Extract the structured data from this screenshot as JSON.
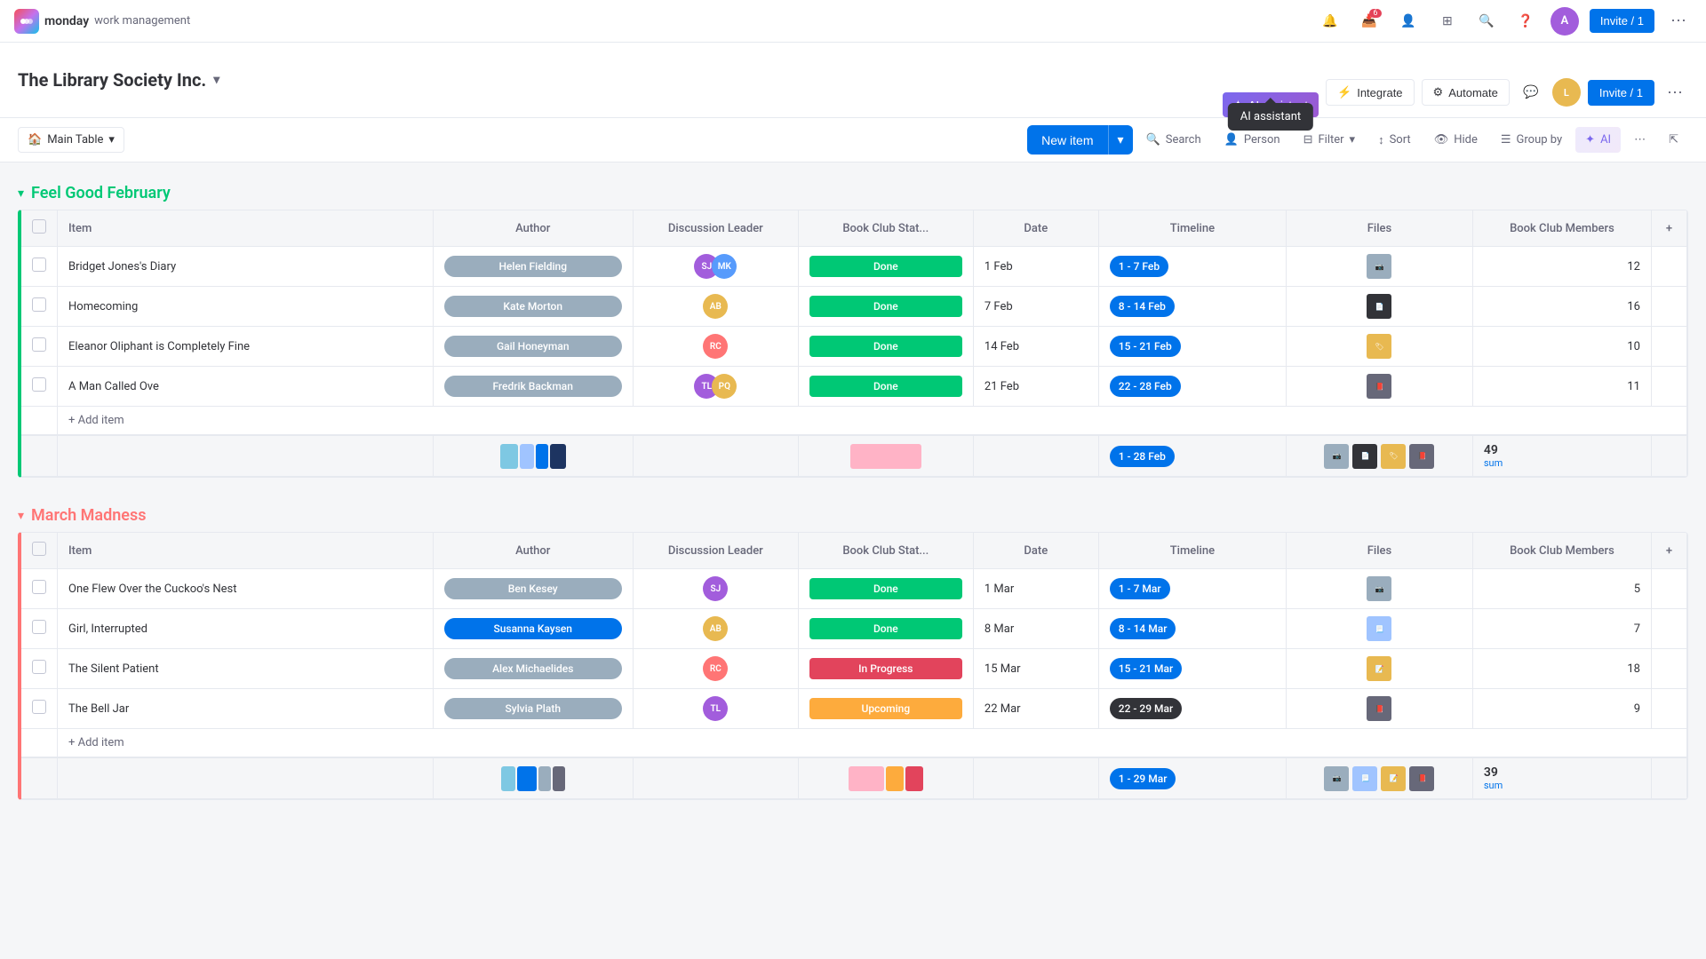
{
  "app": {
    "name": "monday",
    "tagline": "work management"
  },
  "topNav": {
    "notifications_label": "Notifications",
    "inbox_label": "Inbox",
    "inbox_badge": "6",
    "invite_people_label": "Invite people",
    "apps_label": "Apps",
    "search_label": "Search",
    "help_label": "Help",
    "invite_btn": "Invite / 1",
    "more_label": "More"
  },
  "boardHeader": {
    "title": "The Library Society Inc.",
    "ai_assistant_btn": "AI assistant",
    "integrate_btn": "Integrate",
    "automate_btn": "Automate",
    "more_label": "More"
  },
  "toolbar": {
    "table_name": "Main Table",
    "new_item_btn": "New item",
    "search_btn": "Search",
    "person_btn": "Person",
    "filter_btn": "Filter",
    "sort_btn": "Sort",
    "hide_btn": "Hide",
    "group_by_btn": "Group by",
    "ai_btn": "AI",
    "more_btn": "More",
    "collapse_btn": "Collapse"
  },
  "groups": [
    {
      "id": "feel-good-february",
      "title": "Feel Good February",
      "color": "#00c875",
      "columns": [
        "Item",
        "Author",
        "Discussion Leader",
        "Book Club Stat...",
        "Date",
        "Timeline",
        "Files",
        "Book Club Members"
      ],
      "items": [
        {
          "name": "Bridget Jones's Diary",
          "author": "Helen Fielding",
          "author_class": "author-helen",
          "discussion_leader_initials": "SJ",
          "discussion_leader_class": "a1",
          "has_second_avatar": true,
          "second_initials": "MK",
          "second_class": "a2",
          "status": "Done",
          "status_class": "status-done",
          "date": "1 Feb",
          "timeline": "1 - 7 Feb",
          "timeline_class": "timeline-feb",
          "files_count": 1,
          "members": 12
        },
        {
          "name": "Homecoming",
          "author": "Kate Morton",
          "author_class": "author-kate",
          "discussion_leader_initials": "AB",
          "discussion_leader_class": "b1",
          "has_second_avatar": false,
          "status": "Done",
          "status_class": "status-done",
          "date": "7 Feb",
          "timeline": "8 - 14 Feb",
          "timeline_class": "timeline-feb",
          "files_count": 1,
          "members": 16
        },
        {
          "name": "Eleanor Oliphant is Completely Fine",
          "author": "Gail Honeyman",
          "author_class": "author-gail",
          "discussion_leader_initials": "RC",
          "discussion_leader_class": "c1",
          "has_second_avatar": false,
          "status": "Done",
          "status_class": "status-done",
          "date": "14 Feb",
          "timeline": "15 - 21 Feb",
          "timeline_class": "timeline-feb",
          "files_count": 1,
          "members": 10
        },
        {
          "name": "A Man Called Ove",
          "author": "Fredrik Backman",
          "author_class": "author-fredrik",
          "discussion_leader_initials": "TL",
          "discussion_leader_class": "d1",
          "has_second_avatar": true,
          "second_initials": "PQ",
          "second_class": "d2",
          "status": "Done",
          "status_class": "status-done",
          "date": "21 Feb",
          "timeline": "22 - 28 Feb",
          "timeline_class": "timeline-feb",
          "files_count": 1,
          "members": 11
        }
      ],
      "add_item_label": "+ Add item",
      "summary": {
        "timeline": "1 - 28 Feb",
        "timeline_class": "timeline-feb",
        "total_members": "49",
        "sum_label": "sum"
      }
    },
    {
      "id": "march-madness",
      "title": "March Madness",
      "color": "#ff7575",
      "columns": [
        "Item",
        "Author",
        "Discussion Leader",
        "Book Club Stat...",
        "Date",
        "Timeline",
        "Files",
        "Book Club Members"
      ],
      "items": [
        {
          "name": "One Flew Over the Cuckoo's Nest",
          "author": "Ben Kesey",
          "author_class": "author-ben",
          "discussion_leader_initials": "SJ",
          "discussion_leader_class": "a1",
          "has_second_avatar": false,
          "status": "Done",
          "status_class": "status-done",
          "date": "1 Mar",
          "timeline": "1 - 7 Mar",
          "timeline_class": "timeline-mar-current",
          "files_count": 1,
          "members": 5
        },
        {
          "name": "Girl, Interrupted",
          "author": "Susanna Kaysen",
          "author_class": "author-susanna",
          "discussion_leader_initials": "AB",
          "discussion_leader_class": "b1",
          "has_second_avatar": false,
          "status": "Done",
          "status_class": "status-done",
          "date": "8 Mar",
          "timeline": "8 - 14 Mar",
          "timeline_class": "timeline-mar-current",
          "files_count": 1,
          "members": 7
        },
        {
          "name": "The Silent Patient",
          "author": "Alex Michaelides",
          "author_class": "author-alex",
          "discussion_leader_initials": "RC",
          "discussion_leader_class": "c1",
          "has_second_avatar": false,
          "status": "In Progress",
          "status_class": "status-inprogress",
          "date": "15 Mar",
          "timeline": "15 - 21 Mar",
          "timeline_class": "timeline-mar-current",
          "files_count": 1,
          "members": 18
        },
        {
          "name": "The Bell Jar",
          "author": "Sylvia Plath",
          "author_class": "author-sylvia",
          "discussion_leader_initials": "TL",
          "discussion_leader_class": "d1",
          "has_second_avatar": false,
          "status": "Upcoming",
          "status_class": "status-upcoming",
          "date": "22 Mar",
          "timeline": "22 - 29 Mar",
          "timeline_class": "timeline-mar",
          "files_count": 1,
          "members": 9
        }
      ],
      "add_item_label": "+ Add item",
      "summary": {
        "timeline": "1 - 29 Mar",
        "timeline_class": "timeline-mar-current",
        "total_members": "39",
        "sum_label": "sum"
      }
    }
  ]
}
